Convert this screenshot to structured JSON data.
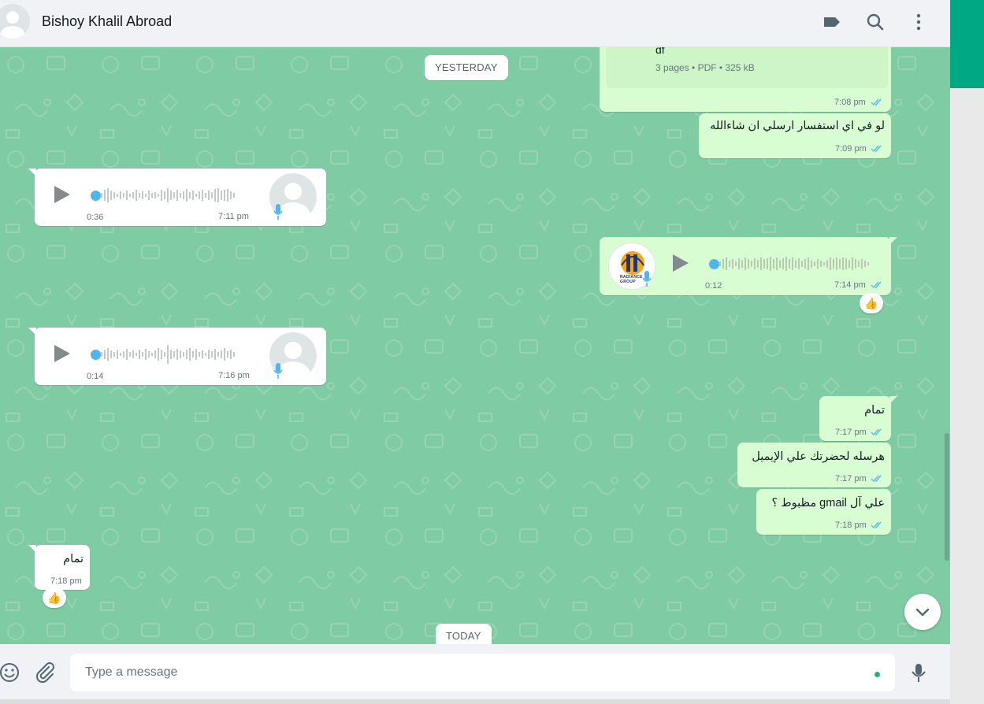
{
  "header": {
    "contact_name": "Bishoy Khalil Abroad",
    "icons": [
      "label-icon",
      "search-icon",
      "menu-icon"
    ]
  },
  "date_chips": {
    "yesterday": "YESTERDAY",
    "today": "TODAY"
  },
  "messages": {
    "doc": {
      "name_fragment": "df",
      "meta": "3 pages • PDF • 325 kB",
      "time": "7:08 pm"
    },
    "m1": {
      "text": "لو في اي استفسار ارسلي ان شاءالله",
      "time": "7:09 pm"
    },
    "v1": {
      "duration": "0:36",
      "time": "7:11 pm"
    },
    "v2": {
      "duration": "0:12",
      "time": "7:14 pm",
      "reaction": "👍",
      "avatar_text": "RADIANCE GROUP"
    },
    "v3": {
      "duration": "0:14",
      "time": "7:16 pm"
    },
    "m2": {
      "text": "تمام",
      "time": "7:17 pm"
    },
    "m3": {
      "text": "هرسله لحضرتك علي الإيميل",
      "time": "7:17 pm"
    },
    "m4": {
      "text": "علي آل gmail مظبوط ؟",
      "time": "7:18 pm"
    },
    "m5": {
      "text": "تمام",
      "time": "7:18 pm",
      "reaction": "👍"
    }
  },
  "footer": {
    "input_placeholder": "Type a message",
    "input_value": ""
  },
  "colors": {
    "chat_bg": "#7fcba3",
    "outgoing_bubble": "#d9fdd3",
    "incoming_bubble": "#ffffff",
    "tick_blue": "#53bdeb",
    "accent_green": "#00a884"
  }
}
